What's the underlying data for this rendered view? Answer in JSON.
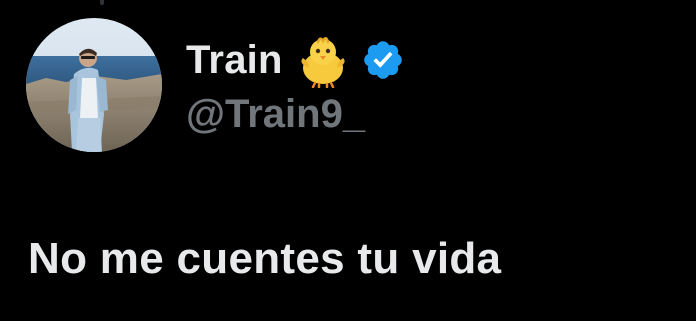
{
  "author": {
    "display_name": "Train",
    "display_name_emoji": "baby-chick-emoji",
    "verified_badge": "verified-badge-icon",
    "handle": "@Train9_"
  },
  "tweet": {
    "text": "No me cuentes tu vida"
  },
  "colors": {
    "background": "#000000",
    "primary_text": "#e7e9ea",
    "secondary_text": "#71767b",
    "verified_blue": "#1d9bf0"
  }
}
